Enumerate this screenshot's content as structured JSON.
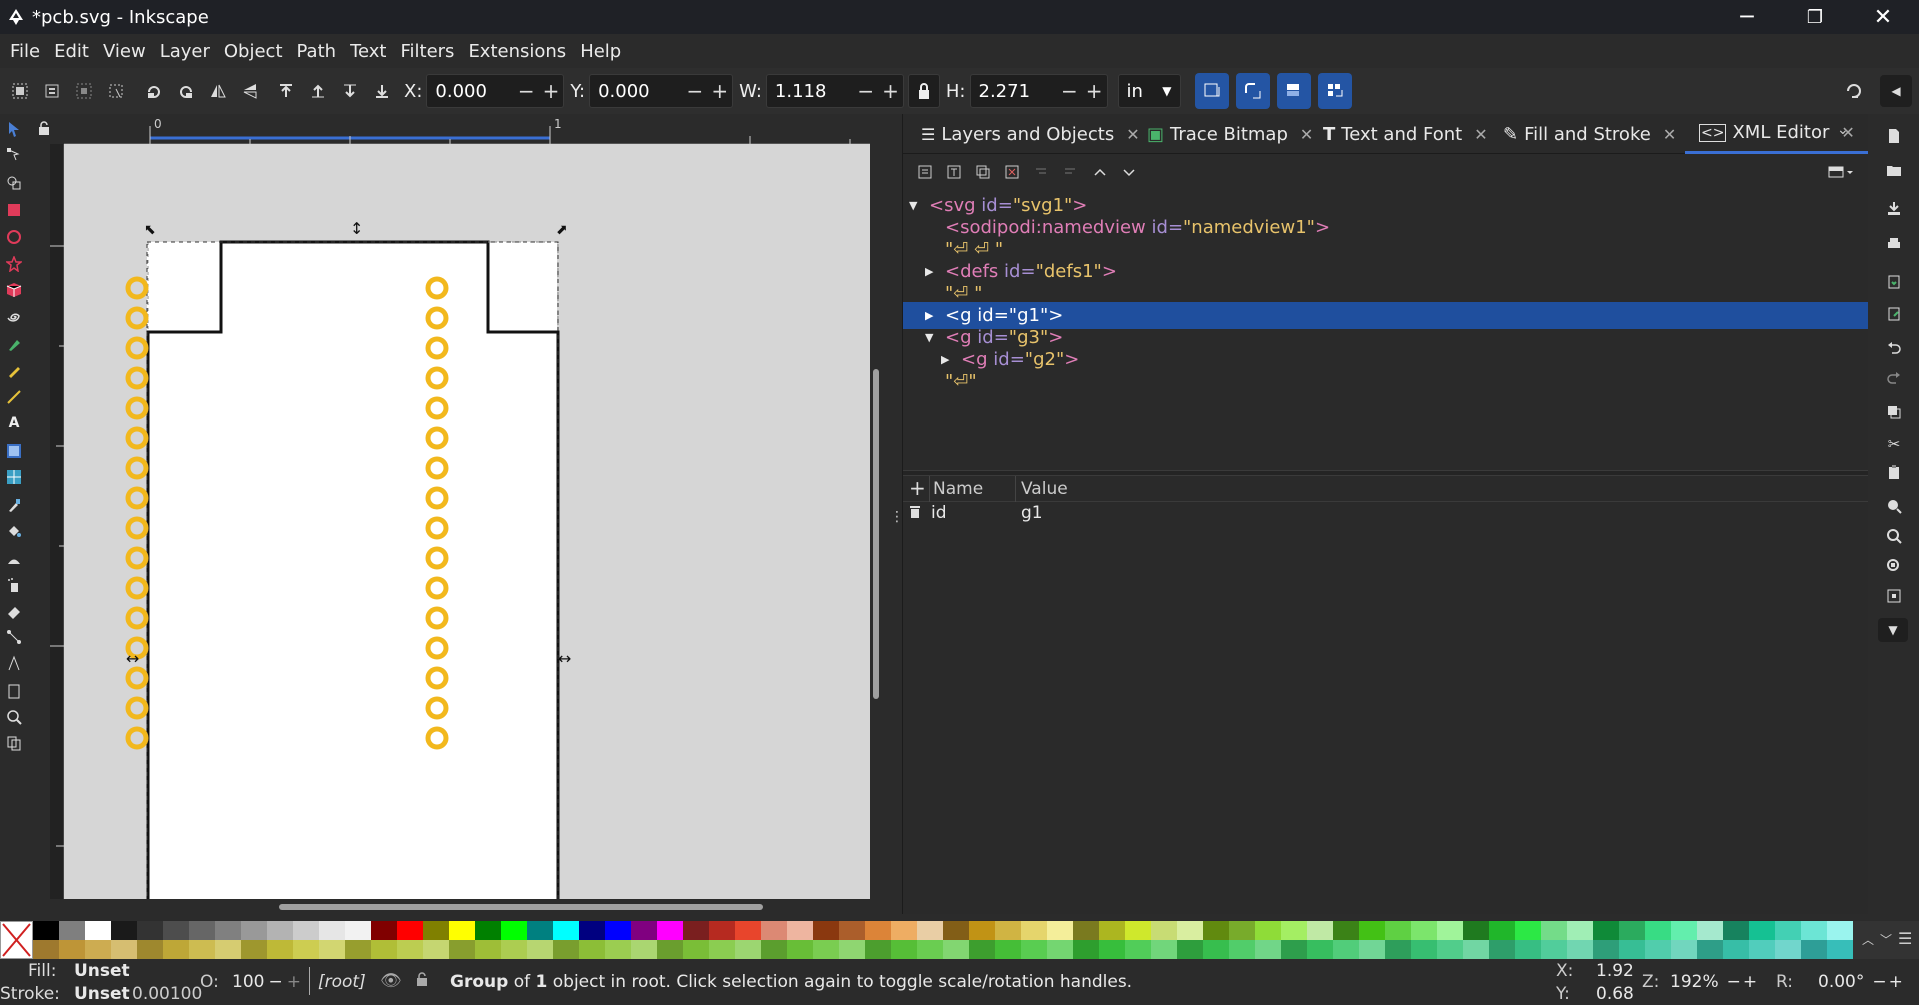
{
  "window": {
    "title": "*pcb.svg - Inkscape",
    "minimize": "─",
    "restore": "❐",
    "close": "✕"
  },
  "menu": [
    "File",
    "Edit",
    "View",
    "Layer",
    "Object",
    "Path",
    "Text",
    "Filters",
    "Extensions",
    "Help"
  ],
  "toolbar": {
    "x_label": "X:",
    "x_value": "0.000",
    "y_label": "Y:",
    "y_value": "0.000",
    "w_label": "W:",
    "w_value": "1.118",
    "h_label": "H:",
    "h_value": "2.271",
    "unit": "in"
  },
  "ruler": {
    "tick0": "0",
    "tick1": "1"
  },
  "dock": {
    "tabs": [
      {
        "label": "Layers and Objects",
        "icon": "layers-icon"
      },
      {
        "label": "Trace Bitmap",
        "icon": "trace-bitmap-icon"
      },
      {
        "label": "Text and Font",
        "icon": "text-font-icon"
      },
      {
        "label": "Fill and Stroke",
        "icon": "fill-stroke-icon"
      },
      {
        "label": "XML Editor",
        "icon": "xml-editor-icon"
      }
    ],
    "xml_nodes": [
      {
        "tag": "svg",
        "attr": "id",
        "val": "\"svg1\"",
        "close": ">"
      },
      {
        "tag": "sodipodi:namedview",
        "attr": "id",
        "val": "\"namedview1\"",
        "close": ">"
      },
      {
        "text": "\"⏎ ⏎ \""
      },
      {
        "tag": "defs",
        "attr": "id",
        "val": "\"defs1\"",
        "close": ">"
      },
      {
        "text": "\"⏎ \""
      },
      {
        "tag": "g",
        "attr": "id",
        "val": "\"g1\"",
        "close": ">"
      },
      {
        "tag": "g",
        "attr": "id",
        "val": "\"g3\"",
        "close": ">"
      },
      {
        "tag": "g",
        "attr": "id",
        "val": "\"g2\"",
        "close": ">"
      },
      {
        "text": "\"⏎\""
      }
    ],
    "attr_header": {
      "add": "+",
      "name": "Name",
      "value": "Value"
    },
    "attributes": [
      {
        "name": "id",
        "value": "g1"
      }
    ]
  },
  "status": {
    "fill_label": "Fill:",
    "fill_value": "Unset",
    "stroke_label": "Stroke:",
    "stroke_value": "Unset",
    "stroke_width": "0.00100",
    "opacity_label": "O:",
    "opacity_value": "100",
    "layer": "[root]",
    "message_pre": "Group",
    "message_mid": " of ",
    "message_count": "1",
    "message_post": " object in root. Click selection again to toggle scale/rotation handles.",
    "x_label": "X:",
    "x_value": "1.92",
    "y_label": "Y:",
    "y_value": "0.68",
    "zoom_label": "Z:",
    "zoom_value": "192%",
    "rot_label": "R:",
    "rot_value": "0.00°"
  },
  "colors": {
    "accent": "#2455a4",
    "selection": "#1f4f9e",
    "pad": "#f2b81d"
  }
}
